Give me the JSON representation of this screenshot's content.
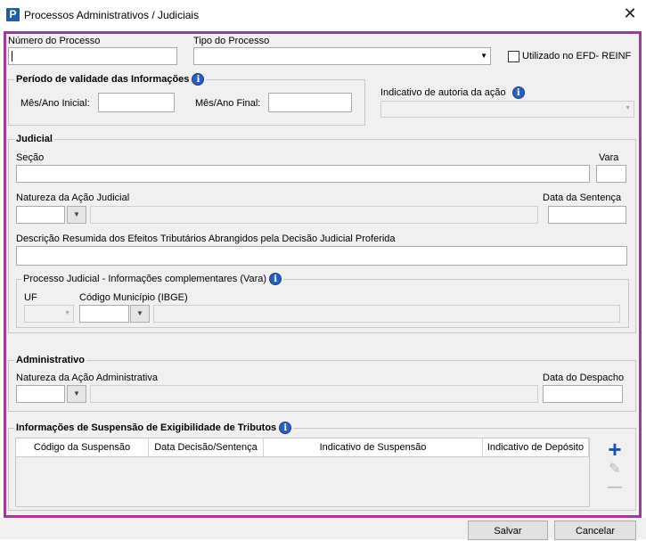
{
  "window": {
    "title": "Processos Administrativos / Judiciais",
    "close_symbol": "✕",
    "app_icon_letter": "P"
  },
  "top": {
    "numero_label": "Número do Processo",
    "numero_value": "",
    "tipo_label": "Tipo do Processo",
    "tipo_value": "",
    "efd_label": "Utilizado no EFD- REINF",
    "efd_checked": false
  },
  "periodo": {
    "legend": "Período de validade das Informações",
    "mes_inicial_label": "Mês/Ano Inicial:",
    "mes_final_label": "Mês/Ano Final:",
    "mes_inicial_value": "",
    "mes_final_value": ""
  },
  "autoria": {
    "label": "Indicativo de autoria da ação",
    "value": ""
  },
  "judicial": {
    "legend": "Judicial",
    "secao_label": "Seção",
    "vara_label": "Vara",
    "natureza_label": "Natureza da Ação Judicial",
    "data_sentenca_label": "Data da Sentença",
    "descricao_label": "Descrição Resumida dos Efeitos Tributários Abrangidos pela Decisão Judicial Proferida",
    "complementares": {
      "legend": "Processo Judicial - Informações complementares (Vara)",
      "uf_label": "UF",
      "municipio_label": "Código Município (IBGE)"
    }
  },
  "administrativo": {
    "legend": "Administrativo",
    "natureza_label": "Natureza da Ação Administrativa",
    "data_despacho_label": "Data do Despacho"
  },
  "suspensao": {
    "legend": "Informações de Suspensão de Exigibilidade de Tributos",
    "columns": [
      "Código da Suspensão",
      "Data Decisão/Sentença",
      "Indicativo de Suspensão",
      "Indicativo de Depósito"
    ],
    "rows": []
  },
  "icons": {
    "info": "i",
    "dropdown": "▼",
    "add": "+",
    "edit": "✎",
    "remove": "—"
  },
  "buttons": {
    "save": "Salvar",
    "cancel": "Cancelar"
  },
  "colors": {
    "frame": "#9b3d98",
    "info_icon": "#2a5fc0",
    "add_icon": "#1f4fb5"
  }
}
